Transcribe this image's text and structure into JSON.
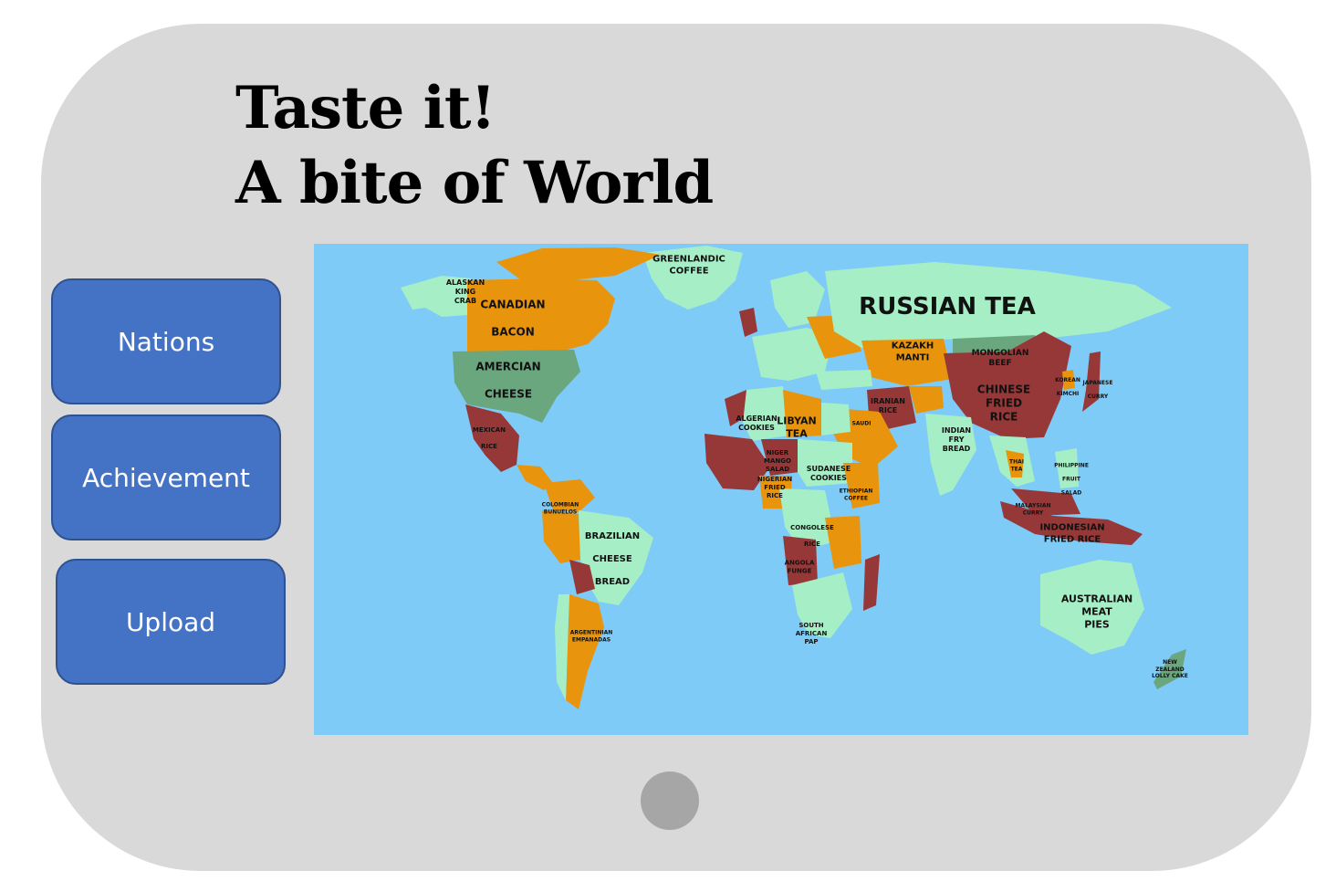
{
  "header": {
    "title_line1": "Taste it!",
    "title_line2": "A bite of World"
  },
  "nav": {
    "nations": "Nations",
    "achievement": "Achievement",
    "upload": "Upload"
  },
  "map": {
    "labels": {
      "greenlandic": "GREENLANDIC\nCOFFEE",
      "russian": "RUSSIAN TEA",
      "alaskan": "ALASKAN\nKING\nCRAB",
      "canadian": "CANADIAN\n\nBACON",
      "american": "AMERCIAN\n\nCHEESE",
      "mexican": "MEXICAN\n\nRICE",
      "brazilian": "BRAZILIAN\n\nCHEESE\n\nBREAD",
      "argentinian": "ARGENTINIAN\nEMPANADAS",
      "colombian": "COLOMBIAN\nBUNUELOS",
      "algerian": "ALGERIAN\nCOOKIES",
      "libyan": "LIBYAN\nTEA",
      "niger": "NIGER\nMANGO\nSALAD",
      "nigerian": "NIGERIAN\nFRIED\nRICE",
      "sudanese": "SUDANESE\nCOOKIES",
      "ethiopian": "ETHIOPIAN\nCOFFEE",
      "congolese": "CONGOLESE\n\nRICE",
      "angola": "ANGOLA\nFUNGE",
      "south_african": "SOUTH\nAFRICAN\nPAP",
      "kazakh": "KAZAKH\nMANTI",
      "mongolian": "MONGOLIAN\nBEEF",
      "chinese": "CHINESE\nFRIED\nRICE",
      "iranian": "IRANIAN\nRICE",
      "saudi": "SAUDI",
      "indian": "INDIAN\nFRY\nBREAD",
      "japanese": "JAPANESE\n\nCURRY",
      "korean": "KOREAN\n\nKIMCHI",
      "thai": "THAI\nTEA",
      "philippine": "PHILIPPINE\n\nFRUIT\n\nSALAD",
      "malaysian": "MALAYSIAN\nCURRY",
      "indonesian": "INDONESIAN\nFRIED RICE",
      "australian": "AUSTRALIAN\nMEAT\nPIES",
      "new_zealand": "NEW\nZEALAND\nLOLLY CAKE"
    },
    "colors": {
      "ocean": "#7ecbf8",
      "green": "#a6efc6",
      "orange": "#e8940c",
      "maroon": "#963838",
      "teal": "#6aa67e"
    }
  },
  "device": {
    "home_button_icon": "circle-home-icon"
  }
}
